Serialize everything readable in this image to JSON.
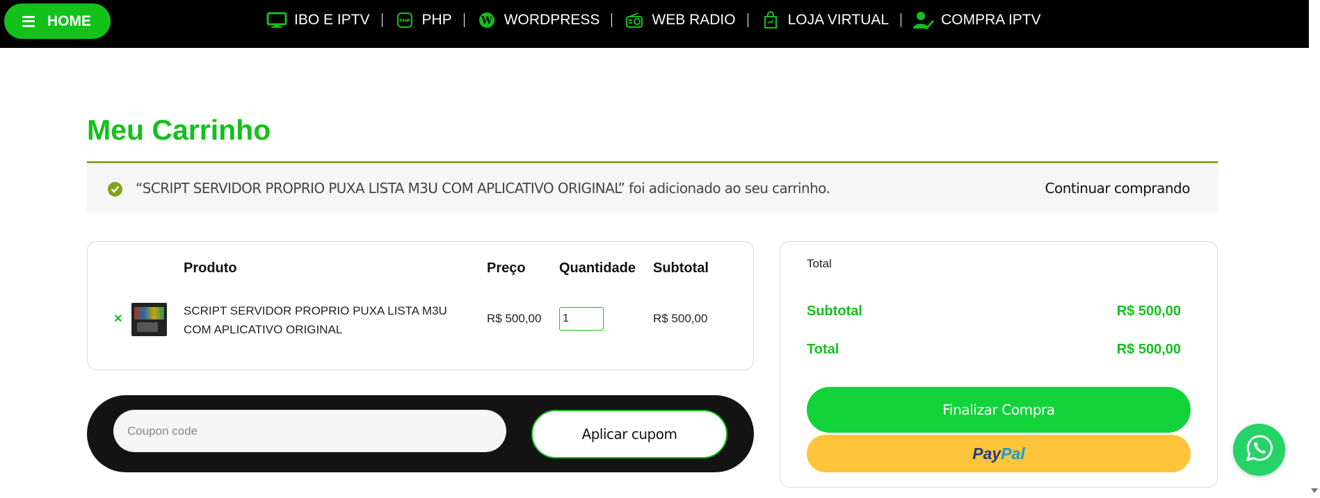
{
  "nav": {
    "home_label": "HOME",
    "items": [
      {
        "label": "IBO E IPTV",
        "icon": "monitor-icon"
      },
      {
        "label": "PHP",
        "icon": "php-icon"
      },
      {
        "label": "WORDPRESS",
        "icon": "wordpress-icon"
      },
      {
        "label": "WEB RADIO",
        "icon": "radio-icon"
      },
      {
        "label": "LOJA VIRTUAL",
        "icon": "shopping-bag-icon"
      },
      {
        "label": "COMPRA IPTV",
        "icon": "user-edit-icon"
      }
    ]
  },
  "page": {
    "title": "Meu Carrinho"
  },
  "notice": {
    "message": "“SCRIPT SERVIDOR PROPRIO PUXA LISTA M3U COM APLICATIVO ORIGINAL” foi adicionado ao seu carrinho.",
    "continue_label": "Continuar comprando"
  },
  "cart": {
    "headers": {
      "product": "Produto",
      "price": "Preço",
      "quantity": "Quantidade",
      "subtotal": "Subtotal"
    },
    "items": [
      {
        "remove": "×",
        "name": "SCRIPT SERVIDOR PROPRIO PUXA LISTA M3U COM APLICATIVO ORIGINAL",
        "price": "R$ 500,00",
        "quantity": "1",
        "subtotal": "R$ 500,00"
      }
    ]
  },
  "coupon": {
    "placeholder": "Coupon code",
    "button_label": "Aplicar cupom"
  },
  "totals": {
    "header": "Total",
    "subtotal_label": "Subtotal",
    "subtotal_value": "R$ 500,00",
    "total_label": "Total",
    "total_value": "R$ 500,00",
    "checkout_label": "Finalizar Compra",
    "paypal_label_1": "Pay",
    "paypal_label_2": "Pal"
  },
  "colors": {
    "brand_green": "#13c11b",
    "notice_accent": "#80a21c",
    "paypal_yellow": "#ffc439",
    "whatsapp_green": "#25d366"
  }
}
